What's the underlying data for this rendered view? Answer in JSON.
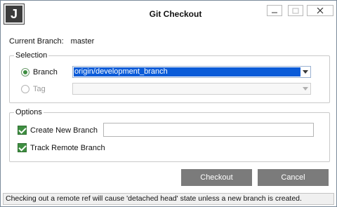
{
  "window": {
    "title": "Git Checkout",
    "app_icon_letter": "J"
  },
  "current_branch": {
    "label": "Current Branch:",
    "value": "master"
  },
  "selection": {
    "legend": "Selection",
    "branch_label": "Branch",
    "branch_value": "origin/development_branch",
    "tag_label": "Tag",
    "tag_value": ""
  },
  "options": {
    "legend": "Options",
    "create_new_branch_label": "Create New Branch",
    "new_branch_name": "",
    "track_remote_branch_label": "Track Remote Branch"
  },
  "buttons": {
    "checkout": "Checkout",
    "cancel": "Cancel"
  },
  "status": "Checking out a remote ref will cause 'detached head' state unless a new branch is created.",
  "colors": {
    "accent_green": "#3e8e41",
    "selection_blue": "#0a5bd8",
    "button_gray": "#7b7b7b"
  }
}
